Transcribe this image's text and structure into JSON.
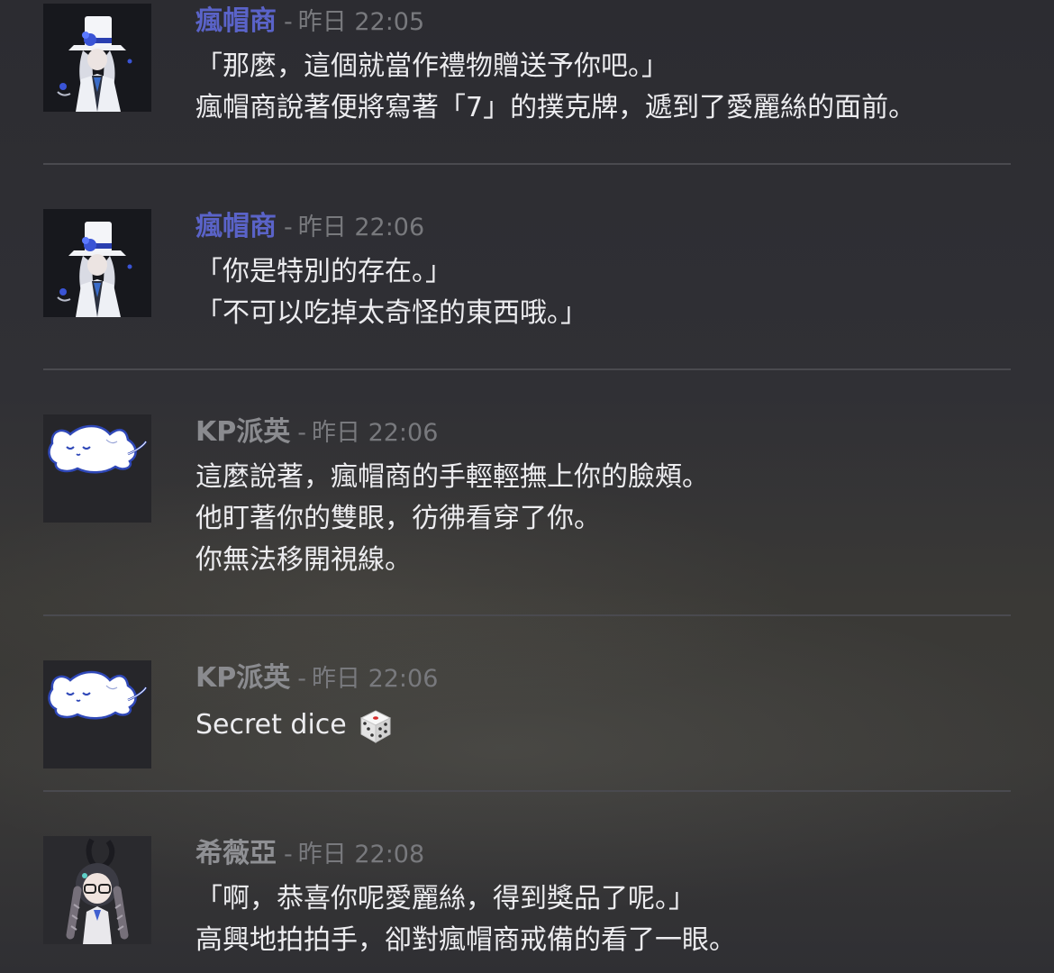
{
  "messages": [
    {
      "author": "瘋帽商",
      "separator": "-",
      "time": "昨日 22:05",
      "avatar_icon": "mad-hatter-avatar-icon",
      "lines": [
        "「那麼，這個就當作禮物贈送予你吧。」",
        "瘋帽商說著便將寫著「7」的撲克牌，遞到了愛麗絲的面前。"
      ]
    },
    {
      "author": "瘋帽商",
      "separator": "-",
      "time": "昨日 22:06",
      "avatar_icon": "mad-hatter-avatar-icon",
      "lines": [
        "「你是特別的存在。」",
        "「不可以吃掉太奇怪的東西哦。」"
      ]
    },
    {
      "author": "KP派英",
      "separator": "-",
      "time": "昨日 22:06",
      "avatar_icon": "white-cat-avatar-icon",
      "lines": [
        "這麼說著，瘋帽商的手輕輕撫上你的臉頰。",
        "他盯著你的雙眼，彷彿看穿了你。",
        "你無法移開視線。"
      ]
    },
    {
      "author": "KP派英",
      "separator": "-",
      "time": "昨日 22:06",
      "avatar_icon": "white-cat-avatar-icon",
      "lines": [
        "Secret dice"
      ],
      "emoji_icon": "dice-icon"
    },
    {
      "author": "希薇亞",
      "separator": "-",
      "time": "昨日 22:08",
      "avatar_icon": "braided-girl-avatar-icon",
      "lines": [
        "「啊，恭喜你呢愛麗絲，得到獎品了呢。」",
        "高興地拍拍手，卻對瘋帽商戒備的看了一眼。"
      ]
    }
  ],
  "colors": {
    "author_hatter": "#5a63c8",
    "author_kp": "#8a8b8f",
    "timestamp": "#78797d",
    "message_text": "#ececef",
    "divider": "#4a4a4f"
  }
}
